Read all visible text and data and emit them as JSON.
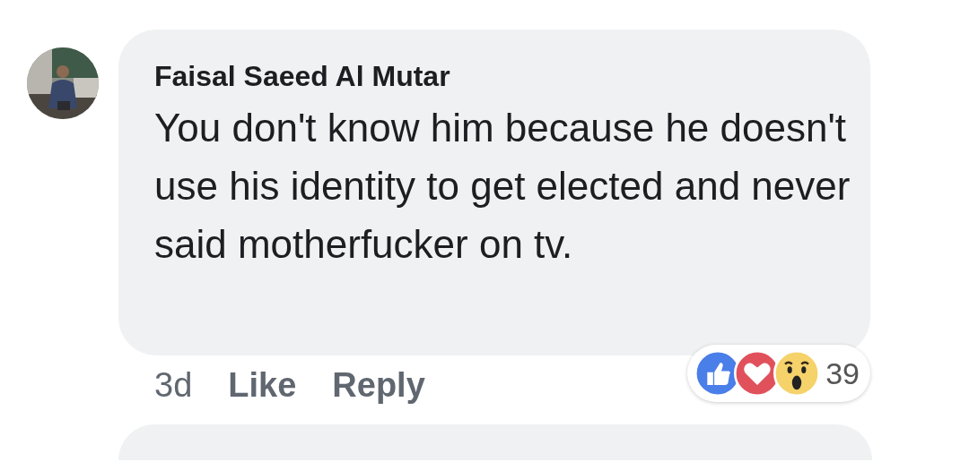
{
  "comment": {
    "author": "Faisal Saeed Al Mutar",
    "text": "You don't know him because he doesn't use his identity to get elected and never said motherfucker on tv.",
    "actions": [
      {
        "kind": "time",
        "label": "3d"
      },
      {
        "kind": "link",
        "label": "Like"
      },
      {
        "kind": "link",
        "label": "Reply"
      }
    ],
    "reactions": {
      "types": [
        {
          "kind": "like"
        },
        {
          "kind": "love"
        },
        {
          "kind": "wow"
        }
      ],
      "count": "39"
    }
  },
  "next_comment": {
    "kind": "bubble"
  }
}
